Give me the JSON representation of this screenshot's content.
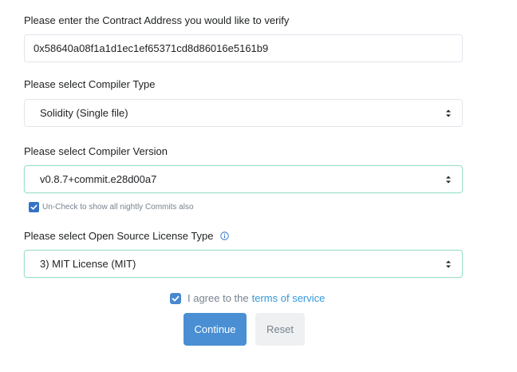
{
  "contract_address": {
    "label": "Please enter the Contract Address you would like to verify",
    "value": "0x58640a08f1a1d1ec1ef65371cd8d86016e5161b9"
  },
  "compiler_type": {
    "label": "Please select Compiler Type",
    "selected": "Solidity (Single file)"
  },
  "compiler_version": {
    "label": "Please select Compiler Version",
    "selected": "v0.8.7+commit.e28d00a7",
    "nightly_checkbox_label": "Un-Check to show all nightly Commits also",
    "nightly_checked": true
  },
  "license": {
    "label": "Please select Open Source License Type",
    "selected": "3) MIT License (MIT)"
  },
  "agree": {
    "prefix": "I agree to the",
    "link_text": "terms of service",
    "checked": true
  },
  "buttons": {
    "continue": "Continue",
    "reset": "Reset"
  },
  "colors": {
    "primary": "#4a8fd4",
    "link": "#3498db",
    "focus_border": "#9fe0c8",
    "checkbox": "#3574c4"
  }
}
